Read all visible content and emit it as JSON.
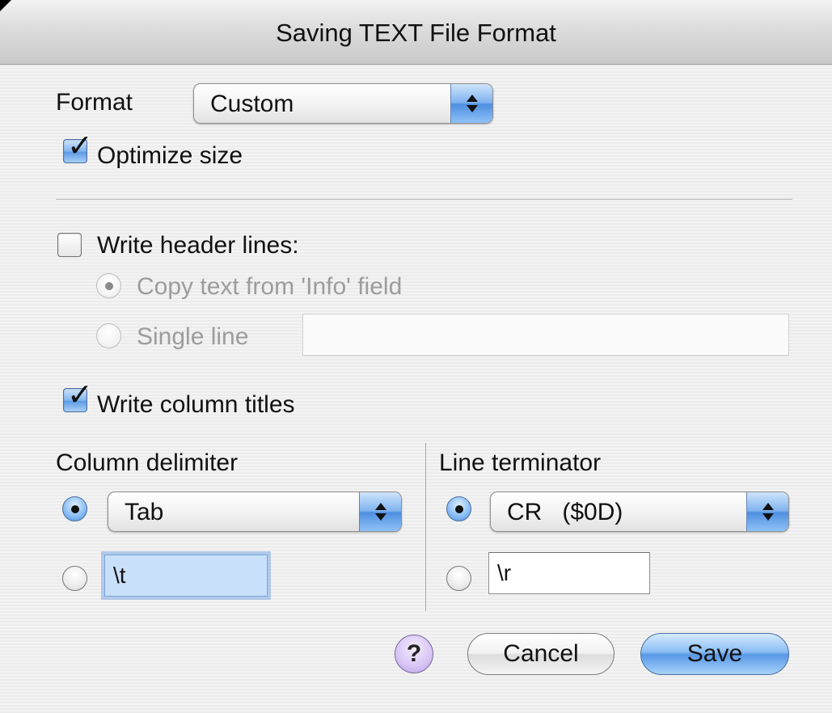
{
  "window": {
    "title": "Saving TEXT File Format"
  },
  "format": {
    "label": "Format",
    "selected": "Custom"
  },
  "optimize": {
    "label": "Optimize size",
    "checked": true
  },
  "header_lines": {
    "label": "Write header lines:",
    "checked": false,
    "copy_info_label": "Copy text from 'Info' field",
    "single_line_label": "Single line",
    "single_line_value": ""
  },
  "column_titles": {
    "label": "Write column titles",
    "checked": true
  },
  "column_delimiter": {
    "label": "Column delimiter",
    "selected": "Tab",
    "custom_value": "\\t"
  },
  "line_terminator": {
    "label": "Line terminator",
    "selected": "CR   ($0D)",
    "custom_value": "\\r"
  },
  "buttons": {
    "help": "?",
    "cancel": "Cancel",
    "save": "Save"
  },
  "icons": {
    "checkmark": "checkmark-icon",
    "popup_arrows": "updown-arrows-icon",
    "help": "question-icon"
  },
  "colors": {
    "accent": "#5898e6",
    "focus": "#c9e0fb",
    "help": "#d8c4f5"
  }
}
